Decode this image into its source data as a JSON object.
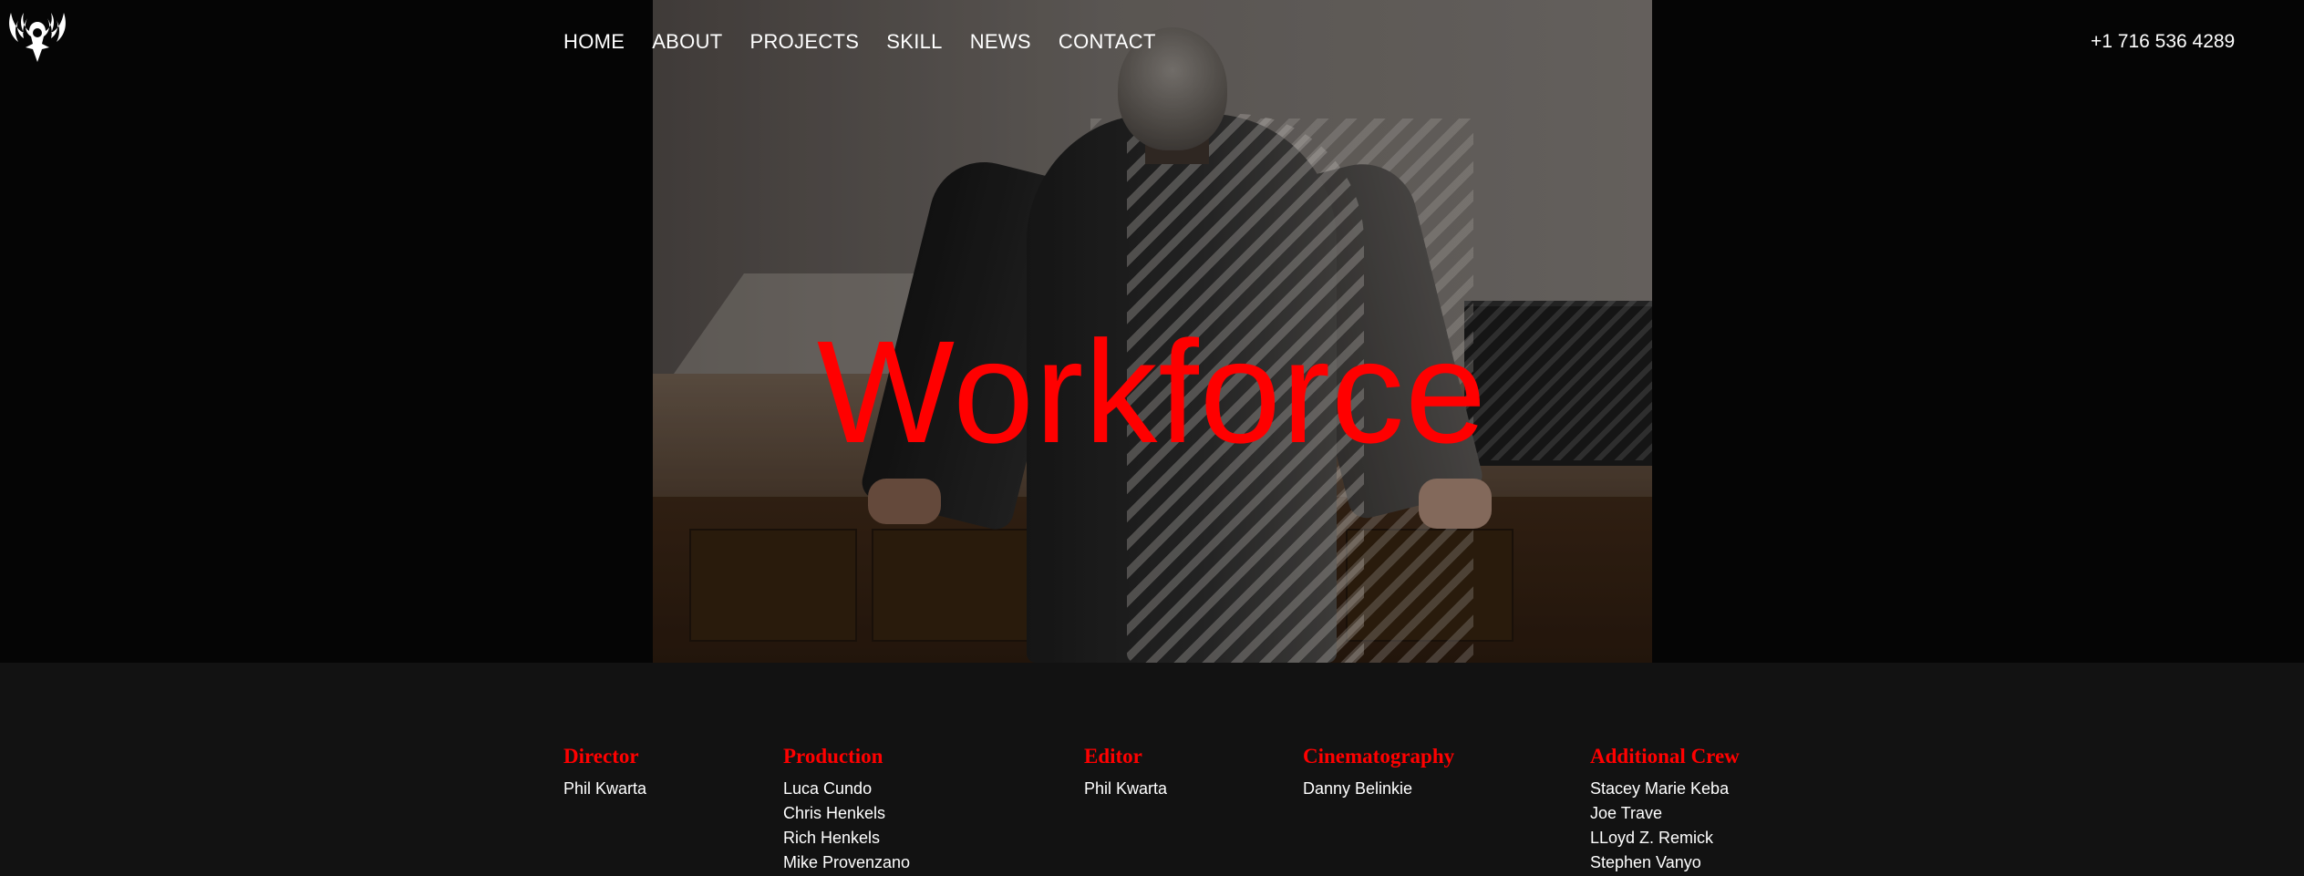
{
  "header": {
    "logo_icon": "winged-crest-icon",
    "nav": [
      {
        "label": "HOME"
      },
      {
        "label": "ABOUT"
      },
      {
        "label": "PROJECTS"
      },
      {
        "label": "SKILL"
      },
      {
        "label": "NEWS"
      },
      {
        "label": "CONTACT"
      }
    ],
    "phone": "+1 716 536 4289"
  },
  "hero": {
    "title": "Workforce",
    "title_color": "#ff0000",
    "image": "man-in-suit-leaning-on-desk-photo"
  },
  "credits": [
    {
      "role": "Director",
      "names": [
        "Phil Kwarta"
      ]
    },
    {
      "role": "Production",
      "names": [
        "Luca Cundo",
        "Chris Henkels",
        "Rich Henkels",
        "Mike Provenzano"
      ]
    },
    {
      "role": "Editor",
      "names": [
        "Phil Kwarta"
      ]
    },
    {
      "role": "Cinematography",
      "names": [
        "Danny Belinkie"
      ]
    },
    {
      "role": "Additional Crew",
      "names": [
        "Stacey Marie Keba",
        "Joe Trave",
        "LLoyd Z. Remick",
        "Stephen Vanyo"
      ]
    }
  ],
  "colors": {
    "accent": "#ff0000",
    "background": "#050505",
    "credits_background": "#121212",
    "text": "#ffffff"
  }
}
